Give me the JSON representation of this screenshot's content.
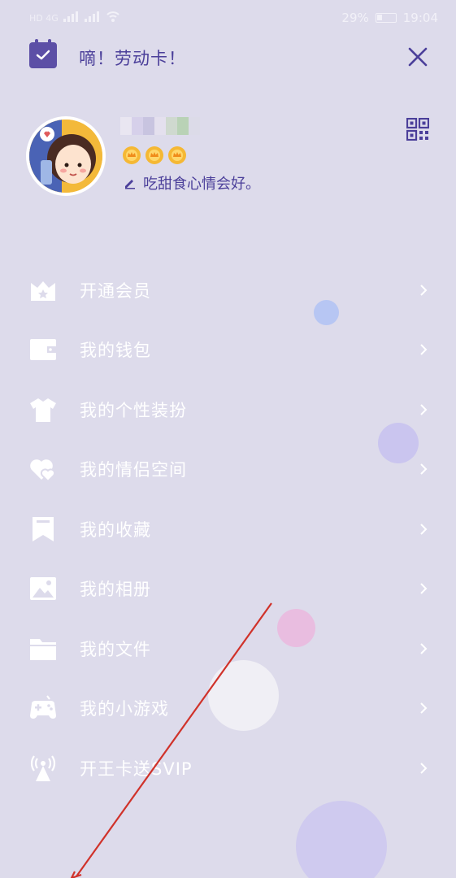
{
  "status_bar": {
    "network_left": "HD 4G",
    "battery": "29%",
    "time": "19:04"
  },
  "header": {
    "punch_card_text": "嘀！劳动卡！"
  },
  "profile": {
    "signature": "吃甜食心情会好。",
    "crowns": 3
  },
  "menu": [
    {
      "label": "开通会员",
      "icon": "vip-icon"
    },
    {
      "label": "我的钱包",
      "icon": "wallet-icon"
    },
    {
      "label": "我的个性装扮",
      "icon": "shirt-icon"
    },
    {
      "label": "我的情侣空间",
      "icon": "hearts-icon"
    },
    {
      "label": "我的收藏",
      "icon": "bookmark-icon"
    },
    {
      "label": "我的相册",
      "icon": "image-icon"
    },
    {
      "label": "我的文件",
      "icon": "folder-icon"
    },
    {
      "label": "我的小游戏",
      "icon": "gamepad-icon"
    },
    {
      "label": "开王卡送SVIP",
      "icon": "signal-tower-icon"
    }
  ],
  "colors": {
    "background": "#dddbeb",
    "accent": "#4b3f9a",
    "menu_text": "#ffffff",
    "annotation": "#d0322a"
  }
}
